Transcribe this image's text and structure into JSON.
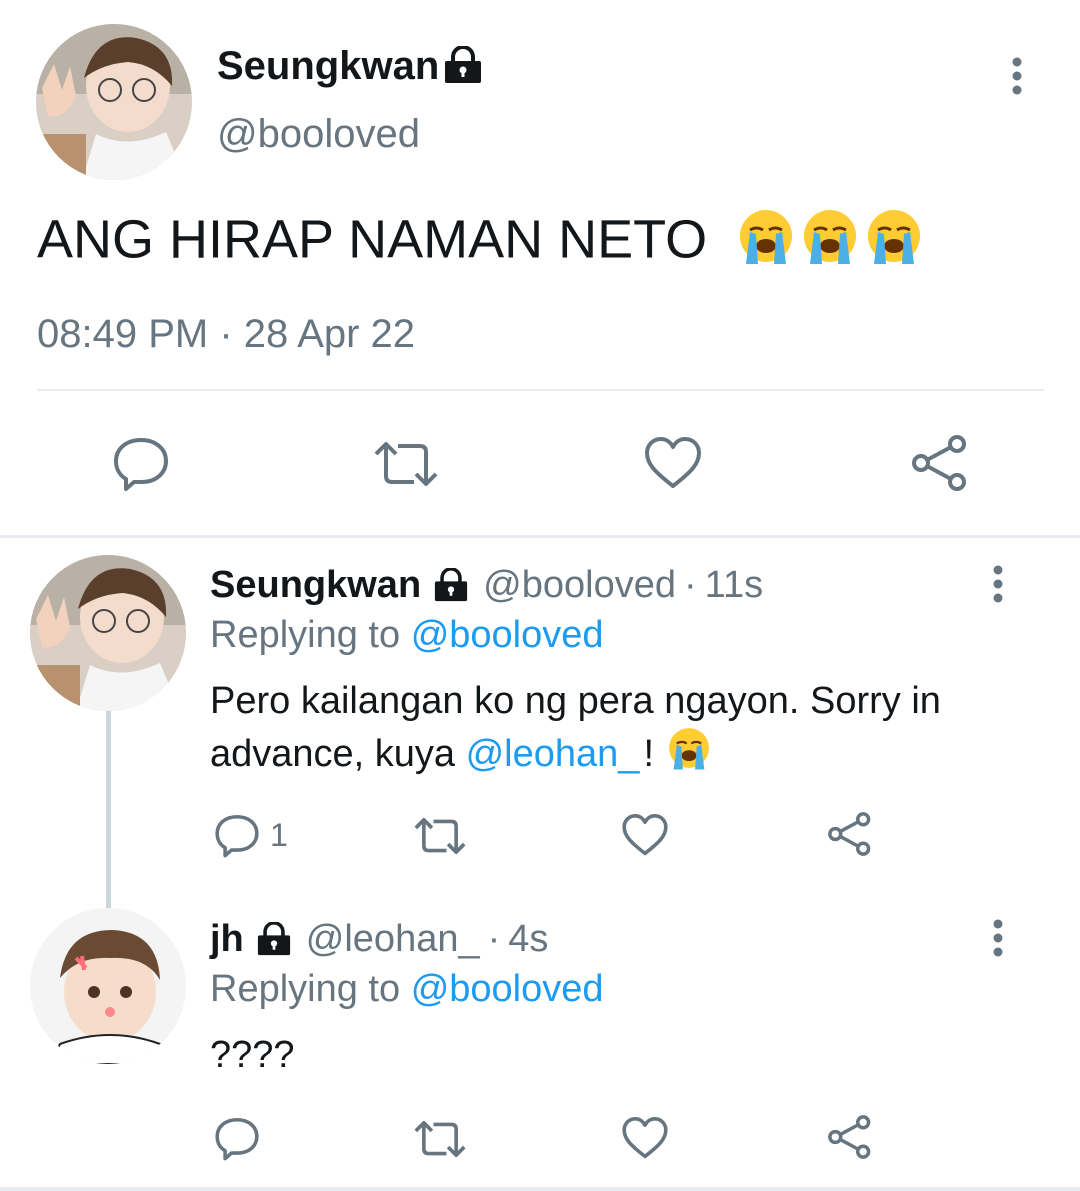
{
  "main_tweet": {
    "display_name": "Seungkwan",
    "handle": "@booloved",
    "text": "ANG HIRAP NAMAN NETO",
    "emojis": [
      "loudly-crying-face",
      "loudly-crying-face",
      "loudly-crying-face"
    ],
    "time": "08:49 PM",
    "separator": "·",
    "date": "28 Apr 22"
  },
  "replies": [
    {
      "display_name": "Seungkwan",
      "handle": "@booloved",
      "time_sep": "·",
      "time": "11s",
      "replying_label": "Replying to",
      "replying_handle": "@booloved",
      "text_line1": "Pero kailangan ko ng pera ngayon. Sorry in",
      "text_line2_pre": "advance, kuya ",
      "mention": "@leohan_",
      "text_line2_post": "!",
      "reply_count": "1"
    },
    {
      "display_name": "jh",
      "handle": "@leohan_",
      "time_sep": "·",
      "time": "4s",
      "replying_label": "Replying to",
      "replying_handle": "@booloved",
      "text": "????"
    }
  ],
  "icons": {
    "lock": "lock-icon",
    "more": "more-vertical-icon",
    "reply": "reply-icon",
    "retweet": "retweet-icon",
    "like": "heart-icon",
    "share": "share-icon"
  },
  "colors": {
    "link_blue": "#1d9bf0",
    "secondary_grey": "#66757f",
    "divider": "#e6ecf0"
  }
}
